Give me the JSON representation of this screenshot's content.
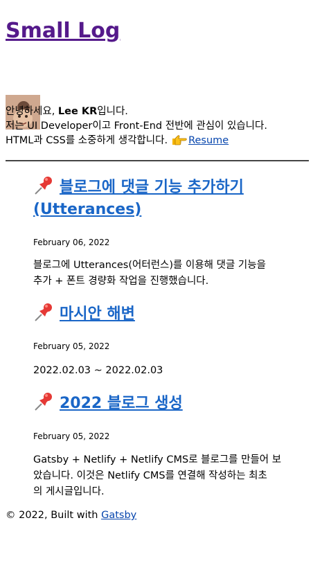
{
  "site": {
    "title": "Small Log"
  },
  "bio": {
    "greeting_pre": "안녕하세요, ",
    "name": "Lee KR",
    "greeting_post": "입니다.",
    "line2": "저는 UI Developer이고 Front-End 전반에 관심이 있습니다.",
    "line3": "HTML과 CSS를 소중하게 생각합니다.",
    "resume_label": "Resume",
    "hand_icon": "pointing-hand-icon"
  },
  "posts": [
    {
      "title_line1": "블로그에 댓글 기능 추가하기",
      "title_line2": "(Utterances)",
      "date": "February 06, 2022",
      "excerpt_line1": "블로그에 Utterances(어터런스)를 이용해 댓글 기능을",
      "excerpt_line2": "추가 + 폰트 경량화 작업을 진행했습니다.",
      "excerpt_line3": "",
      "icon": "pushpin-icon"
    },
    {
      "title_line1": "마시안 해변",
      "title_line2": "",
      "date": "February 05, 2022",
      "excerpt_line1": "2022.02.03 ~ 2022.02.03",
      "excerpt_line2": "",
      "excerpt_line3": "",
      "icon": "pushpin-icon"
    },
    {
      "title_line1": "2022 블로그 생성",
      "title_line2": "",
      "date": "February 05, 2022",
      "excerpt_line1": "Gatsby + Netlify + Netlify CMS로 블로그를 만들어 보",
      "excerpt_line2": "았습니다. 이것은 Netlify CMS를 연결해 작성하는 최초",
      "excerpt_line3": "의 게시글입니다.",
      "icon": "pushpin-icon"
    }
  ],
  "footer": {
    "prefix": "© 2022, Built with ",
    "link_label": "Gatsby"
  },
  "colors": {
    "site_title": "#551a8b",
    "post_title": "#1a66c7",
    "link": "#0645ad",
    "rule": "#444444"
  }
}
